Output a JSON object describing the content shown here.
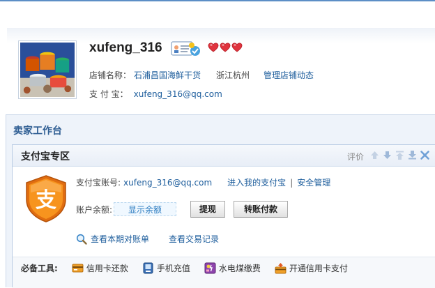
{
  "profile": {
    "username": "xufeng_316",
    "shop_label": "店铺名称：",
    "shop_name": "石浦昌国海鲜干货",
    "location": "浙江杭州",
    "manage_link": "管理店铺动态",
    "alipay_label": "支 付 宝：",
    "alipay_email": "xufeng_316@qq.com",
    "badge_icon": "id-verified-icon",
    "heart_icons": [
      "heart-icon",
      "heart-icon",
      "heart-icon"
    ]
  },
  "workbench": {
    "title": "卖家工作台"
  },
  "alipay_panel": {
    "title": "支付宝专区",
    "rate_label": "评价",
    "account_label": "支付宝账号:",
    "account_value": "xufeng_316@qq.com",
    "enter_link": "进入我的支付宝",
    "separator": "|",
    "security_link": "安全管理",
    "balance_label": "账户余额:",
    "show_balance": "显示余额",
    "withdraw_button": "提现",
    "transfer_button": "转账付款",
    "statement_link": "查看本期对账单",
    "records_link": "查看交易记录"
  },
  "tools": {
    "label": "必备工具:",
    "items": [
      {
        "label": "信用卡还款",
        "icon": "credit-card-icon"
      },
      {
        "label": "手机充值",
        "icon": "mobile-phone-icon"
      },
      {
        "label": "水电煤缴费",
        "icon": "utility-bill-icon"
      },
      {
        "label": "开通信用卡支付",
        "icon": "credit-card-payment-icon"
      }
    ]
  },
  "colors": {
    "accent": "#1d5d9c",
    "panel_border": "#b8cbe3",
    "heart": "#e0343e",
    "alipay_orange": "#f08a1c"
  }
}
